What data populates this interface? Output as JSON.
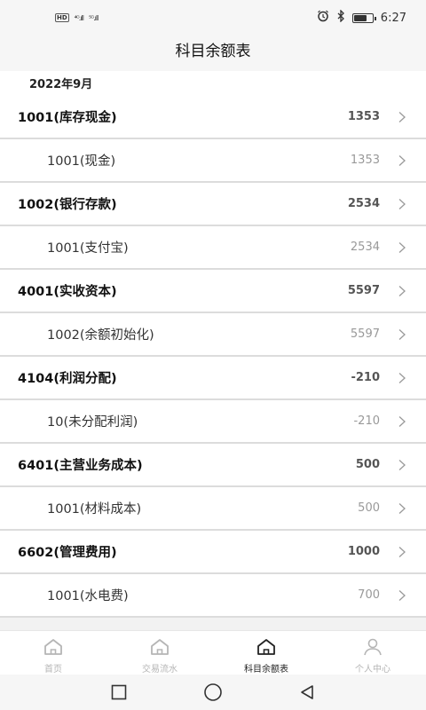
{
  "status_bar": {
    "hd": "HD",
    "signal1": "⁴ᴳ.ıll",
    "signal2": "⁵ᴳ.ıll",
    "time": "6:27",
    "battery_level": 0.75
  },
  "header": {
    "title": "科目余额表"
  },
  "period": "2022年9月",
  "rows": [
    {
      "type": "parent",
      "label": "1001(库存现金)",
      "value": "1353"
    },
    {
      "type": "child",
      "label": "1001(现金)",
      "value": "1353"
    },
    {
      "type": "parent",
      "label": "1002(银行存款)",
      "value": "2534"
    },
    {
      "type": "child",
      "label": "1001(支付宝)",
      "value": "2534"
    },
    {
      "type": "parent",
      "label": "4001(实收资本)",
      "value": "5597"
    },
    {
      "type": "child",
      "label": "1002(余额初始化)",
      "value": "5597"
    },
    {
      "type": "parent",
      "label": "4104(利润分配)",
      "value": "-210"
    },
    {
      "type": "child",
      "label": "10(未分配利润)",
      "value": "-210"
    },
    {
      "type": "parent",
      "label": "6401(主营业务成本)",
      "value": "500"
    },
    {
      "type": "child",
      "label": "1001(材料成本)",
      "value": "500"
    },
    {
      "type": "parent",
      "label": "6602(管理费用)",
      "value": "1000"
    },
    {
      "type": "child",
      "label": "1001(水电费)",
      "value": "700"
    }
  ],
  "tabs": [
    {
      "label": "首页",
      "icon": "home-icon",
      "active": false
    },
    {
      "label": "交易流水",
      "icon": "home-icon",
      "active": false
    },
    {
      "label": "科目余额表",
      "icon": "home-icon",
      "active": true
    },
    {
      "label": "个人中心",
      "icon": "person-icon",
      "active": false
    }
  ],
  "colors": {
    "active": "#222222",
    "inactive": "#b5b5b5",
    "divider": "#dcdcdc"
  }
}
